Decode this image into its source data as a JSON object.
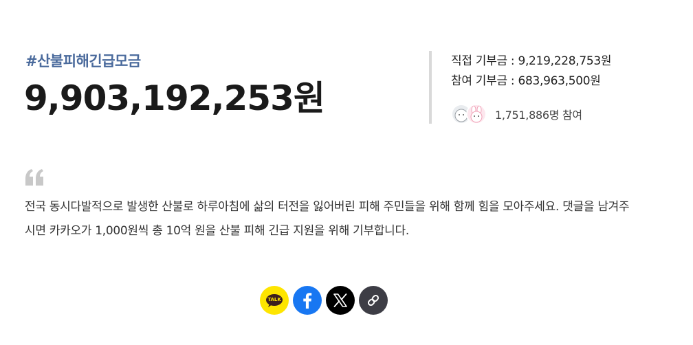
{
  "campaign": {
    "hashtag": "#산불피해긴급모금",
    "total_amount": "9,903,192,253원"
  },
  "stats": {
    "direct_donation": "직접 기부금 : 9,219,228,753원",
    "participation_donation": "참여 기부금 : 683,963,500원",
    "participant_count": "1,751,886명 참여"
  },
  "description": "전국 동시다발적으로 발생한 산불로 하루아침에 삶의 터전을 잃어버린 피해 주민들을 위해 함께 힘을 모아주세요. 댓글을 남겨주시면 카카오가 1,000원씩 총 10억 원을 산불 피해 긴급 지원을 위해 기부합니다.",
  "share": {
    "kakao_label": "TALK",
    "kakao_color": "#fee500",
    "facebook_color": "#1877f2",
    "x_color": "#000000",
    "link_color": "#3d3d45"
  },
  "icons": {
    "quote": "quote-icon",
    "kakao": "kakaotalk-icon",
    "facebook": "facebook-icon",
    "x": "x-icon",
    "link": "link-icon"
  },
  "colors": {
    "hashtag": "#4a6a9c",
    "divider": "#d9d9d9"
  }
}
